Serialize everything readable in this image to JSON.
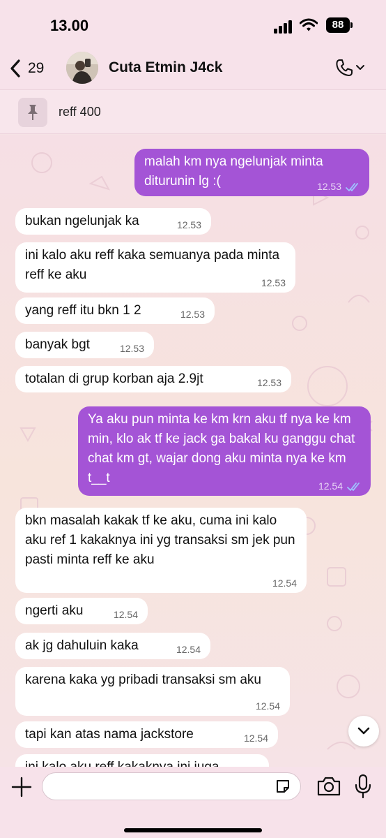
{
  "status_bar": {
    "time": "13.00",
    "battery": "88"
  },
  "header": {
    "back_count": "29",
    "contact_name": "Cuta Etmin J4ck"
  },
  "pinned": {
    "text": "reff 400"
  },
  "messages": [
    {
      "dir": "out",
      "text": "malah km nya ngelunjak minta diturunin lg :(",
      "time": "12.53"
    },
    {
      "dir": "in",
      "text": "bukan ngelunjak ka",
      "time": "12.53"
    },
    {
      "dir": "in",
      "text": "ini kalo aku reff kaka semuanya pada minta reff ke aku",
      "time": "12.53"
    },
    {
      "dir": "in",
      "text": "yang reff itu bkn 1 2",
      "time": "12.53"
    },
    {
      "dir": "in",
      "text": "banyak bgt",
      "time": "12.53"
    },
    {
      "dir": "in",
      "text": "totalan di grup korban aja 2.9jt",
      "time": "12.53"
    },
    {
      "dir": "out",
      "text": "Ya aku pun minta ke km krn aku tf nya ke km min, klo ak tf ke jack ga bakal ku ganggu chat chat km gt, wajar dong aku minta nya ke km t__t",
      "time": "12.54"
    },
    {
      "dir": "in",
      "text": "bkn masalah kakak tf ke aku, cuma ini kalo aku ref 1 kakaknya ini yg transaksi sm jek pun pasti minta reff ke aku",
      "time": "12.54"
    },
    {
      "dir": "in",
      "text": "ngerti aku",
      "time": "12.54"
    },
    {
      "dir": "in",
      "text": "ak jg dahuluin kaka",
      "time": "12.54"
    },
    {
      "dir": "in",
      "text": "karena kaka yg pribadi transaksi sm aku",
      "time": "12.54"
    },
    {
      "dir": "in",
      "text": "tapi kan atas nama jackstore",
      "time": "12.54"
    },
    {
      "dir": "in",
      "text": "ini kalo aku reff kakaknya ini juga",
      "time": ""
    }
  ],
  "composer": {
    "placeholder": ""
  },
  "colors": {
    "outgoing_bubble": "#a454d6",
    "incoming_bubble": "#ffffff",
    "read_ticks": "#5aa0ff"
  },
  "icons": [
    "back-chevron-icon",
    "phone-icon",
    "chevron-down-icon",
    "pin-icon",
    "plus-icon",
    "sticker-icon",
    "camera-icon",
    "mic-icon"
  ]
}
